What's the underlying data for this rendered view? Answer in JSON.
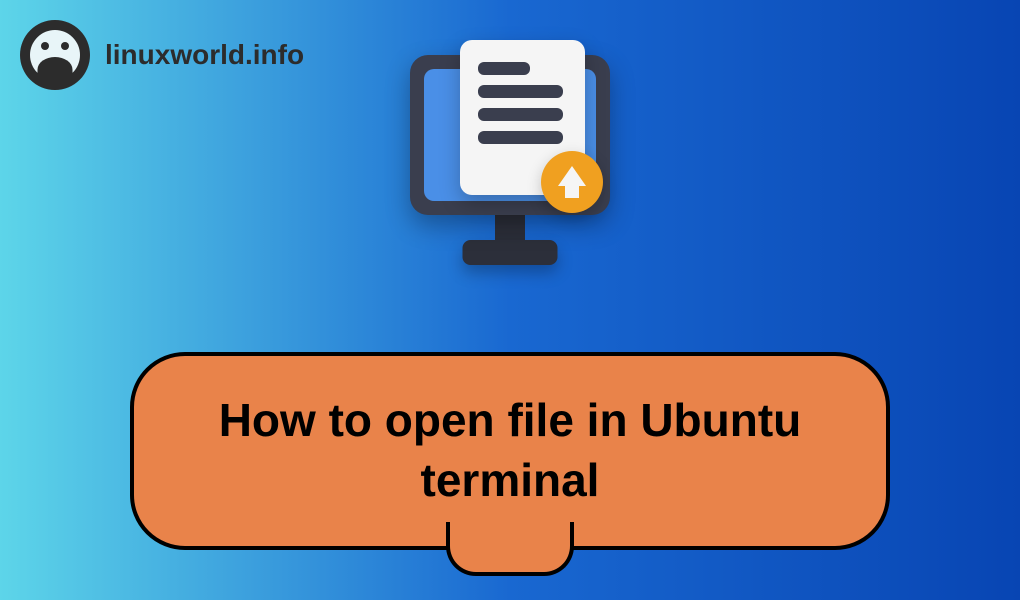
{
  "header": {
    "site_name": "linuxworld.info"
  },
  "banner": {
    "title": "How to open file in Ubuntu terminal"
  }
}
